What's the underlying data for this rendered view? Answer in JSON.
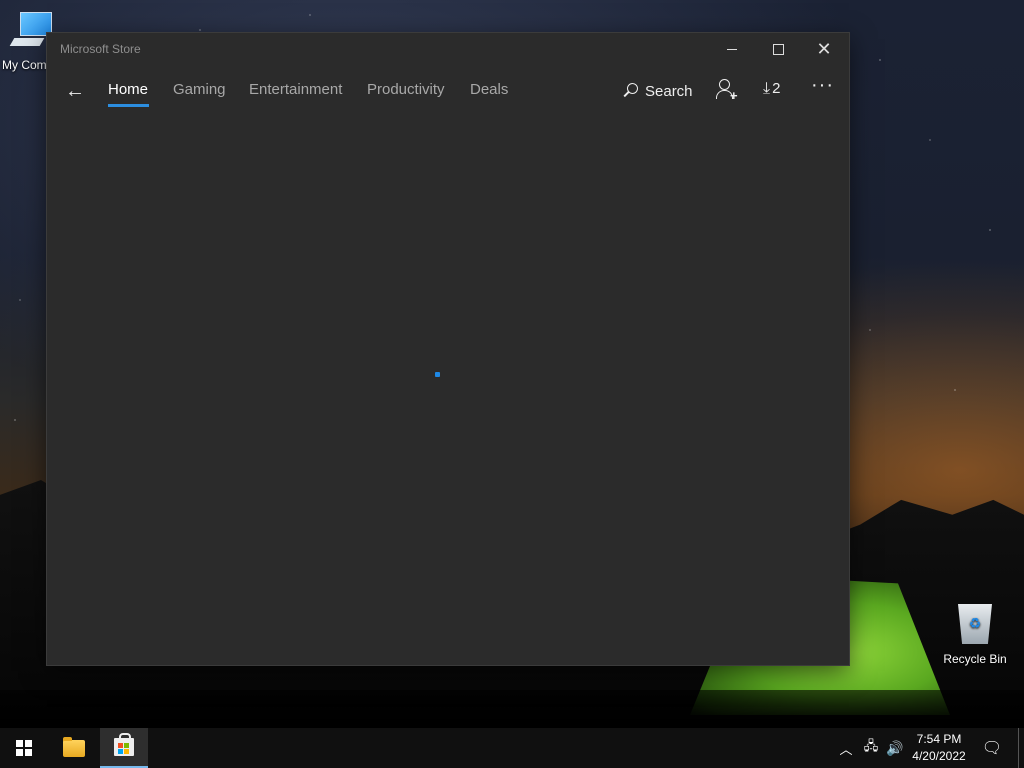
{
  "window": {
    "title": "Microsoft Store"
  },
  "nav": {
    "back": "←",
    "items": [
      {
        "label": "Home",
        "active": true
      },
      {
        "label": "Gaming"
      },
      {
        "label": "Entertainment"
      },
      {
        "label": "Productivity"
      },
      {
        "label": "Deals"
      }
    ],
    "search_label": "Search",
    "downloads_count": "2",
    "more": "···"
  },
  "desktop": {
    "icons": [
      {
        "label": "My Com",
        "icon": "computer-icon"
      },
      {
        "label": "Recycle Bin",
        "icon": "recycle-bin-icon"
      }
    ]
  },
  "taskbar": {
    "time": "7:54 PM",
    "date": "4/20/2022",
    "pinned": [
      "start-icon",
      "file-explorer-icon",
      "microsoft-store-icon"
    ]
  },
  "colors": {
    "accent": "#2c8ee0",
    "window_bg": "#2b2b2b",
    "taskbar_bg": "#101010"
  }
}
